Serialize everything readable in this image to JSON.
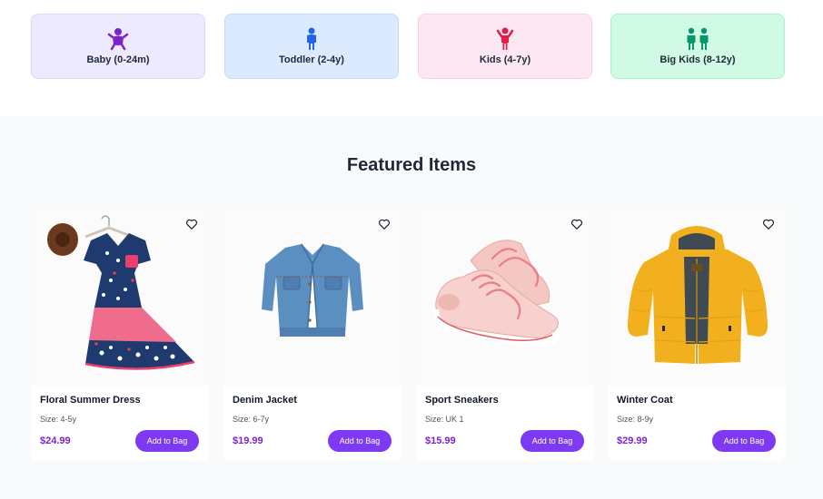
{
  "categories": [
    {
      "label": "Baby (0-24m)",
      "icon": "baby-icon",
      "color": "#7e22ce"
    },
    {
      "label": "Toddler (2-4y)",
      "icon": "toddler-icon",
      "color": "#2563eb"
    },
    {
      "label": "Kids (4-7y)",
      "icon": "child-icon",
      "color": "#e11d48"
    },
    {
      "label": "Big Kids (8-12y)",
      "icon": "children-icon",
      "color": "#059669"
    }
  ],
  "featured": {
    "title": "Featured Items",
    "add_label": "Add to Bag",
    "items": [
      {
        "name": "Floral Summer Dress",
        "size": "Size: 4-5y",
        "price": "$24.99",
        "image": "floral-dress-image"
      },
      {
        "name": "Denim Jacket",
        "size": "Size: 6-7y",
        "price": "$19.99",
        "image": "denim-jacket-image"
      },
      {
        "name": "Sport Sneakers",
        "size": "Size: UK 1",
        "price": "$15.99",
        "image": "sneakers-image"
      },
      {
        "name": "Winter Coat",
        "size": "Size: 8-9y",
        "price": "$29.99",
        "image": "winter-coat-image"
      }
    ]
  },
  "colors": {
    "accent": "#7e3af2",
    "price": "#7e22ce",
    "section_bg": "#f8fafc"
  }
}
